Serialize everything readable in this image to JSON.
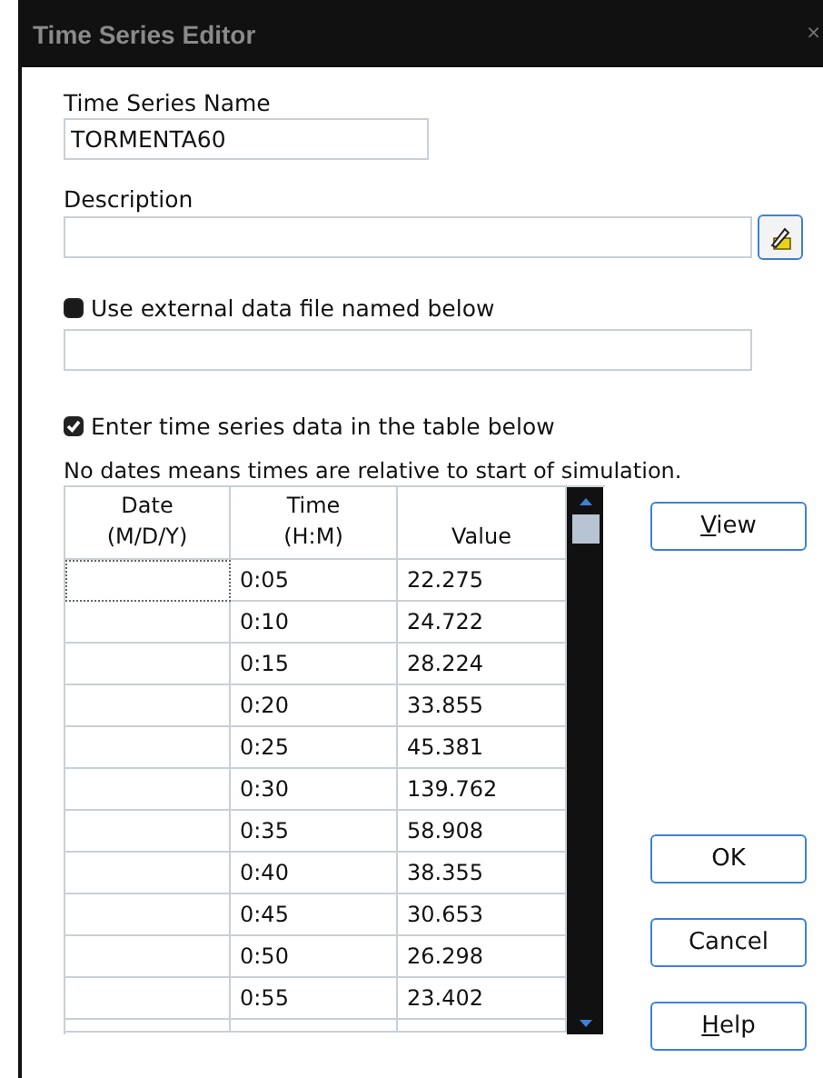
{
  "window": {
    "title": "Time Series Editor",
    "close": "×"
  },
  "name_field": {
    "label": "Time Series Name",
    "value": "TORMENTA60"
  },
  "description_field": {
    "label": "Description"
  },
  "external_file": {
    "label": "Use external data file named below",
    "checked": false
  },
  "table_option": {
    "label": "Enter time series data in the table below",
    "checked": true
  },
  "note": "No dates means times are relative to start of simulation.",
  "table": {
    "columns": [
      {
        "line1": "Date",
        "line2": "(M/D/Y)"
      },
      {
        "line1": "Time",
        "line2": "(H:M)"
      },
      {
        "line2": "Value"
      }
    ],
    "rows": [
      {
        "date": "",
        "time": "0:05",
        "value": "22.275",
        "focused": true
      },
      {
        "date": "",
        "time": "0:10",
        "value": "24.722",
        "focused": false
      },
      {
        "date": "",
        "time": "0:15",
        "value": "28.224",
        "focused": false
      },
      {
        "date": "",
        "time": "0:20",
        "value": "33.855",
        "focused": false
      },
      {
        "date": "",
        "time": "0:25",
        "value": "45.381",
        "focused": false
      },
      {
        "date": "",
        "time": "0:30",
        "value": "139.762",
        "focused": false
      },
      {
        "date": "",
        "time": "0:35",
        "value": "58.908",
        "focused": false
      },
      {
        "date": "",
        "time": "0:40",
        "value": "38.355",
        "focused": false
      },
      {
        "date": "",
        "time": "0:45",
        "value": "30.653",
        "focused": false
      },
      {
        "date": "",
        "time": "0:50",
        "value": "26.298",
        "focused": false
      },
      {
        "date": "",
        "time": "0:55",
        "value": "23.402",
        "focused": false
      }
    ]
  },
  "buttons": [
    {
      "label": "View",
      "underline_first": true,
      "kind": "top"
    },
    {
      "label": "OK",
      "underline_first": false,
      "kind": "bottom"
    },
    {
      "label": "Cancel",
      "underline_first": false,
      "kind": "bottom"
    },
    {
      "label": "Help",
      "underline_first": true,
      "kind": "bottom"
    }
  ]
}
